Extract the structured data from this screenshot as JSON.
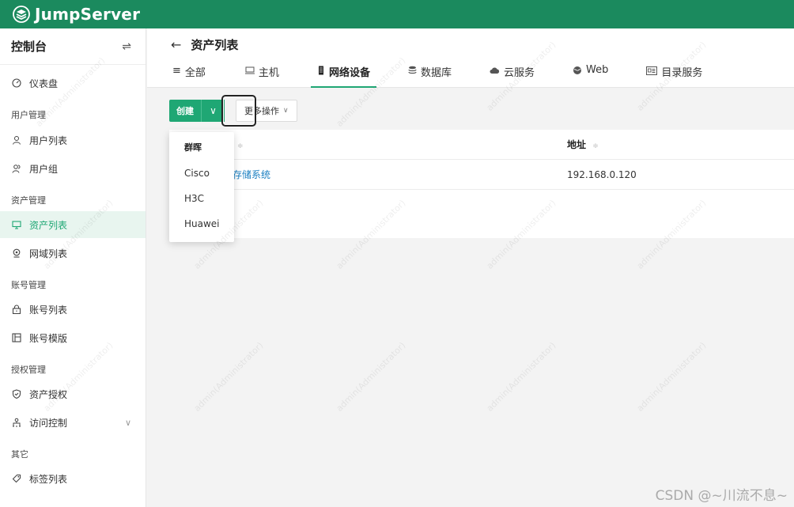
{
  "brand": {
    "name": "JumpServer"
  },
  "sidebar": {
    "title": "控制台",
    "toggle_icon": "⇌",
    "groups": [
      {
        "label": "用户管理"
      },
      {
        "label": "资产管理"
      },
      {
        "label": "账号管理"
      },
      {
        "label": "授权管理"
      },
      {
        "label": "其它"
      }
    ],
    "items": [
      {
        "label": "仪表盘",
        "icon": "dashboard-icon"
      },
      {
        "label": "用户列表",
        "icon": "user-icon"
      },
      {
        "label": "用户组",
        "icon": "user-group-icon"
      },
      {
        "label": "资产列表",
        "icon": "monitor-icon",
        "active": true
      },
      {
        "label": "网域列表",
        "icon": "location-icon"
      },
      {
        "label": "账号列表",
        "icon": "lock-icon"
      },
      {
        "label": "账号模版",
        "icon": "template-icon"
      },
      {
        "label": "资产授权",
        "icon": "shield-icon"
      },
      {
        "label": "访问控制",
        "icon": "access-control-icon"
      },
      {
        "label": "标签列表",
        "icon": "tag-icon"
      }
    ]
  },
  "page": {
    "title": "资产列表",
    "tabs": [
      {
        "label": "全部",
        "icon": "menu-icon"
      },
      {
        "label": "主机",
        "icon": "host-icon"
      },
      {
        "label": "网络设备",
        "icon": "network-device-icon",
        "active": true
      },
      {
        "label": "数据库",
        "icon": "database-icon"
      },
      {
        "label": "云服务",
        "icon": "cloud-icon"
      },
      {
        "label": "Web",
        "icon": "globe-icon"
      },
      {
        "label": "目录服务",
        "icon": "directory-icon"
      }
    ]
  },
  "toolbar": {
    "create_label": "创建",
    "caret": "∨",
    "more_label": "更多操作",
    "more_chevron": "∨"
  },
  "dropdown": {
    "header": "群晖",
    "options": [
      "Cisco",
      "H3C",
      "Huawei"
    ]
  },
  "table": {
    "columns": [
      "地址"
    ],
    "sort_icon": "≑",
    "rows": [
      {
        "name": "存储系统",
        "address": "192.168.0.120"
      }
    ]
  },
  "watermark": "admin(Administrator)",
  "footer_credit": "CSDN @~川流不息~"
}
